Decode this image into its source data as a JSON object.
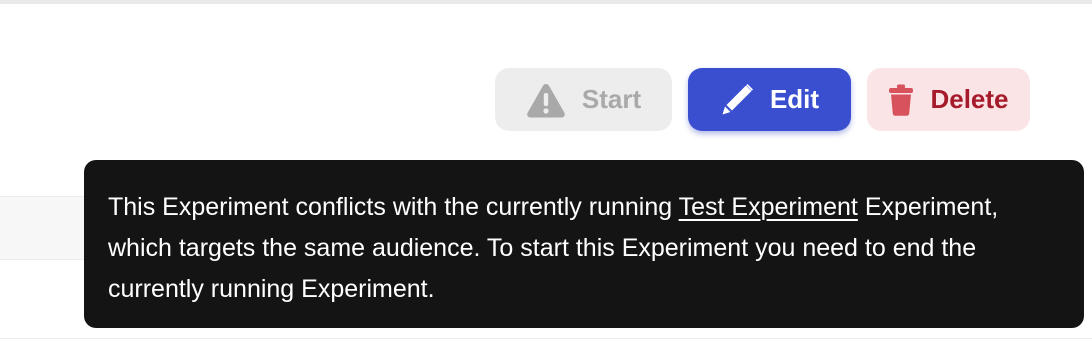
{
  "toolbar": {
    "start_label": "Start",
    "edit_label": "Edit",
    "delete_label": "Delete",
    "start_icon": "warning-triangle-icon",
    "edit_icon": "pencil-icon",
    "delete_icon": "trash-icon"
  },
  "tooltip": {
    "text_before_link": "This Experiment conflicts with the currently running ",
    "link_text": "Test Experiment",
    "text_after_link": " Experiment, which targets the same audience. To start this Experiment you need to end the currently running Experiment."
  },
  "colors": {
    "edit_button_bg": "#3a4fcf",
    "delete_button_bg": "#fbe4e6",
    "delete_button_text": "#a61b2b",
    "start_button_bg": "#ededed",
    "start_button_text": "#a9a9a9",
    "tooltip_bg": "#141414"
  }
}
